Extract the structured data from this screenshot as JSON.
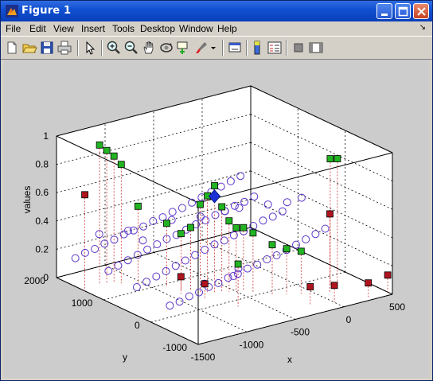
{
  "window": {
    "title": "Figure 1"
  },
  "menu": [
    "File",
    "Edit",
    "View",
    "Insert",
    "Tools",
    "Desktop",
    "Window",
    "Help"
  ],
  "toolbar_icons": [
    "new-figure-icon",
    "open-file-icon",
    "save-icon",
    "print-icon",
    "pointer-icon",
    "zoom-in-icon",
    "zoom-out-icon",
    "pan-icon",
    "rotate-3d-icon",
    "data-cursor-icon",
    "brush-icon",
    "brush-dropdown-icon",
    "link-plot-icon",
    "insert-colorbar-icon",
    "insert-legend-icon",
    "hide-plot-tools-icon",
    "show-plot-tools-icon"
  ],
  "chart_data": {
    "type": "scatter3d",
    "title": "",
    "xlabel": "x",
    "ylabel": "y",
    "zlabel": "values",
    "xlim": [
      -1500,
      500
    ],
    "ylim": [
      -1000,
      2000
    ],
    "zlim": [
      0,
      1
    ],
    "x_ticks": [
      "-1500",
      "-1000",
      "-500",
      "0",
      "500"
    ],
    "y_ticks": [
      "-1000",
      "0",
      "1000",
      "2000"
    ],
    "z_ticks": [
      "0",
      "0.2",
      "0.4",
      "0.6",
      "0.8",
      "1"
    ],
    "grid": true,
    "box": true,
    "series": [
      {
        "marker": "circle",
        "color": "#5b34c9",
        "points": [
          [
            -1500,
            1600,
            0.2
          ],
          [
            -1400,
            1600,
            0.22
          ],
          [
            -1300,
            1600,
            0.23
          ],
          [
            -1200,
            1600,
            0.25
          ],
          [
            -1100,
            1600,
            0.26
          ],
          [
            -1000,
            1600,
            0.28
          ],
          [
            -900,
            1600,
            0.29
          ],
          [
            -800,
            1600,
            0.3
          ],
          [
            -700,
            1600,
            0.32
          ],
          [
            -600,
            1600,
            0.33
          ],
          [
            -500,
            1600,
            0.35
          ],
          [
            -400,
            1600,
            0.36
          ],
          [
            -300,
            1600,
            0.38
          ],
          [
            -200,
            1600,
            0.4
          ],
          [
            -100,
            1600,
            0.42
          ],
          [
            0,
            1600,
            0.44
          ],
          [
            100,
            1600,
            0.46
          ],
          [
            200,
            1600,
            0.48
          ],
          [
            -1500,
            900,
            0.22
          ],
          [
            -1400,
            900,
            0.24
          ],
          [
            -1300,
            900,
            0.26
          ],
          [
            -1200,
            900,
            0.28
          ],
          [
            -1100,
            900,
            0.3
          ],
          [
            -1000,
            900,
            0.32
          ],
          [
            -900,
            900,
            0.34
          ],
          [
            -800,
            900,
            0.35
          ],
          [
            -700,
            900,
            0.37
          ],
          [
            -600,
            900,
            0.39
          ],
          [
            -500,
            900,
            0.4
          ],
          [
            -400,
            900,
            0.42
          ],
          [
            -300,
            900,
            0.43
          ],
          [
            -200,
            900,
            0.45
          ],
          [
            -100,
            900,
            0.46
          ],
          [
            0,
            900,
            0.48
          ],
          [
            -1500,
            300,
            0.2
          ],
          [
            -1400,
            300,
            0.22
          ],
          [
            -1300,
            300,
            0.24
          ],
          [
            -1200,
            300,
            0.26
          ],
          [
            -1100,
            300,
            0.28
          ],
          [
            -1000,
            300,
            0.3
          ],
          [
            -900,
            300,
            0.32
          ],
          [
            -800,
            300,
            0.34
          ],
          [
            -700,
            300,
            0.36
          ],
          [
            -600,
            300,
            0.37
          ],
          [
            -500,
            300,
            0.39
          ],
          [
            -400,
            300,
            0.4
          ],
          [
            -300,
            300,
            0.42
          ],
          [
            -200,
            300,
            0.44
          ],
          [
            -100,
            300,
            0.45
          ],
          [
            0,
            300,
            0.47
          ],
          [
            -1500,
            -400,
            0.18
          ],
          [
            -1400,
            -400,
            0.19
          ],
          [
            -1300,
            -400,
            0.21
          ],
          [
            -1200,
            -400,
            0.22
          ],
          [
            -1100,
            -400,
            0.24
          ],
          [
            -1000,
            -400,
            0.25
          ],
          [
            -900,
            -400,
            0.27
          ],
          [
            -800,
            -400,
            0.28
          ],
          [
            -700,
            -400,
            0.3
          ],
          [
            -600,
            -400,
            0.31
          ],
          [
            -500,
            -400,
            0.33
          ],
          [
            -400,
            -400,
            0.34
          ],
          [
            -300,
            -400,
            0.36
          ],
          [
            -200,
            -400,
            0.38
          ],
          [
            -100,
            -400,
            0.4
          ],
          [
            0,
            -400,
            0.42
          ],
          [
            100,
            -400,
            0.44
          ],
          [
            -1400,
            1300,
            0.4
          ],
          [
            -1200,
            1100,
            0.42
          ],
          [
            -1000,
            1200,
            0.3
          ],
          [
            -800,
            1000,
            0.44
          ],
          [
            -600,
            800,
            0.46
          ],
          [
            -400,
            700,
            0.48
          ],
          [
            -300,
            600,
            0.5
          ],
          [
            -100,
            400,
            0.52
          ],
          [
            0,
            200,
            0.55
          ],
          [
            100,
            100,
            0.58
          ],
          [
            -700,
            -100,
            0.2
          ],
          [
            -600,
            0,
            0.22
          ],
          [
            -900,
            100,
            0.15
          ]
        ]
      },
      {
        "marker": "square",
        "color": "#22b422",
        "points": [
          [
            -1300,
            1500,
            0.98
          ],
          [
            -1250,
            1450,
            0.94
          ],
          [
            -1200,
            1400,
            0.9
          ],
          [
            -1150,
            1350,
            0.84
          ],
          [
            -1050,
            1200,
            0.55
          ],
          [
            -900,
            900,
            0.45
          ],
          [
            -850,
            700,
            0.4
          ],
          [
            -800,
            600,
            0.45
          ],
          [
            -750,
            500,
            0.62
          ],
          [
            -700,
            450,
            0.68
          ],
          [
            -650,
            400,
            0.75
          ],
          [
            -600,
            350,
            0.6
          ],
          [
            -550,
            300,
            0.5
          ],
          [
            -500,
            250,
            0.45
          ],
          [
            -450,
            200,
            0.45
          ],
          [
            -400,
            100,
            0.42
          ],
          [
            -300,
            -100,
            0.35
          ],
          [
            -200,
            -200,
            0.32
          ],
          [
            -100,
            -300,
            0.3
          ],
          [
            200,
            -300,
            0.9
          ],
          [
            250,
            -350,
            0.9
          ],
          [
            -700,
            -200,
            0.3
          ]
        ]
      },
      {
        "marker": "square",
        "color": "#b0141e",
        "points": [
          [
            -1500,
            1400,
            0.68
          ],
          [
            -900,
            600,
            0.12
          ],
          [
            -800,
            300,
            0.1
          ],
          [
            100,
            -500,
            0.56
          ],
          [
            -200,
            -700,
            0.13
          ],
          [
            0,
            -800,
            0.12
          ],
          [
            300,
            -900,
            0.1
          ],
          [
            500,
            -900,
            0.12
          ]
        ]
      },
      {
        "marker": "diamond",
        "color": "#1a2fd6",
        "points": [
          [
            -700,
            300,
            0.7
          ]
        ]
      }
    ]
  }
}
